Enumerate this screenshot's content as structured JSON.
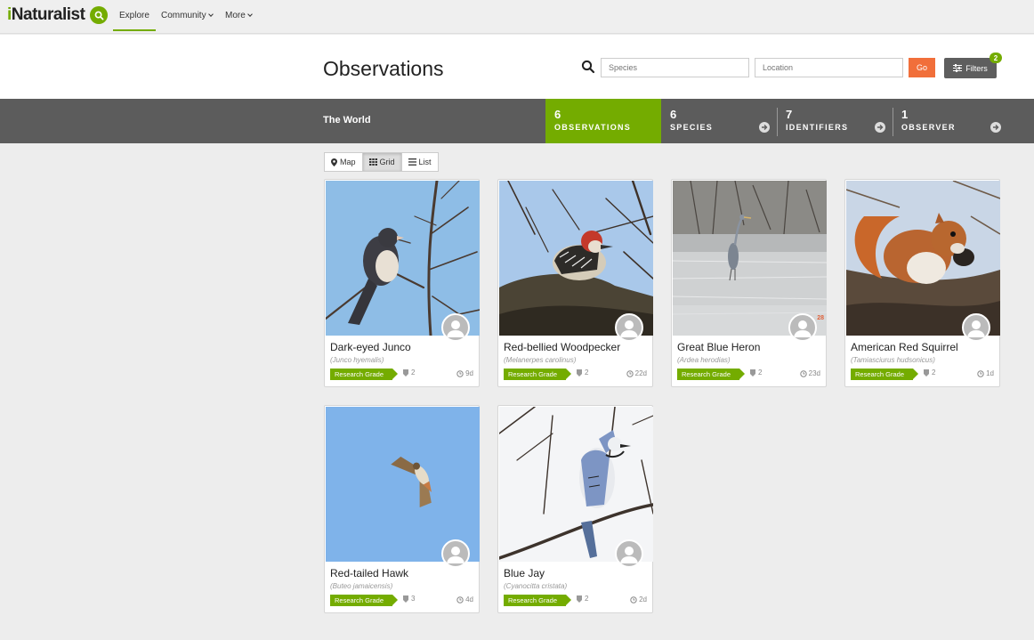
{
  "nav": {
    "logo_i": "i",
    "logo_rest": "Naturalist",
    "explore": "Explore",
    "community": "Community",
    "more": "More"
  },
  "header": {
    "title": "Observations",
    "species_placeholder": "Species",
    "location_placeholder": "Location",
    "go": "Go",
    "filters": "Filters",
    "filters_count": "2"
  },
  "stats": {
    "place": "The World",
    "items": [
      {
        "num": "6",
        "label": "OBSERVATIONS"
      },
      {
        "num": "6",
        "label": "SPECIES"
      },
      {
        "num": "7",
        "label": "IDENTIFIERS"
      },
      {
        "num": "1",
        "label": "OBSERVER"
      }
    ]
  },
  "views": {
    "map": "Map",
    "grid": "Grid",
    "list": "List"
  },
  "observations": [
    {
      "name": "Dark-eyed Junco",
      "sci": "(Junco hyemalis)",
      "grade": "Research Grade",
      "ids": "2",
      "age": "9d",
      "photo_count": ""
    },
    {
      "name": "Red-bellied Woodpecker",
      "sci": "(Melanerpes carolinus)",
      "grade": "Research Grade",
      "ids": "2",
      "age": "22d",
      "photo_count": ""
    },
    {
      "name": "Great Blue Heron",
      "sci": "(Ardea herodias)",
      "grade": "Research Grade",
      "ids": "2",
      "age": "23d",
      "photo_count": "28"
    },
    {
      "name": "American Red Squirrel",
      "sci": "(Tamiasciurus hudsonicus)",
      "grade": "Research Grade",
      "ids": "2",
      "age": "1d",
      "photo_count": ""
    },
    {
      "name": "Red-tailed Hawk",
      "sci": "(Buteo jamaicensis)",
      "grade": "Research Grade",
      "ids": "3",
      "age": "4d",
      "photo_count": ""
    },
    {
      "name": "Blue Jay",
      "sci": "(Cyanocitta cristata)",
      "grade": "Research Grade",
      "ids": "2",
      "age": "2d",
      "photo_count": ""
    }
  ],
  "colors": {
    "brand_green": "#74ac00",
    "go_orange": "#f16f3a",
    "stats_bar": "#5c5c5c"
  }
}
